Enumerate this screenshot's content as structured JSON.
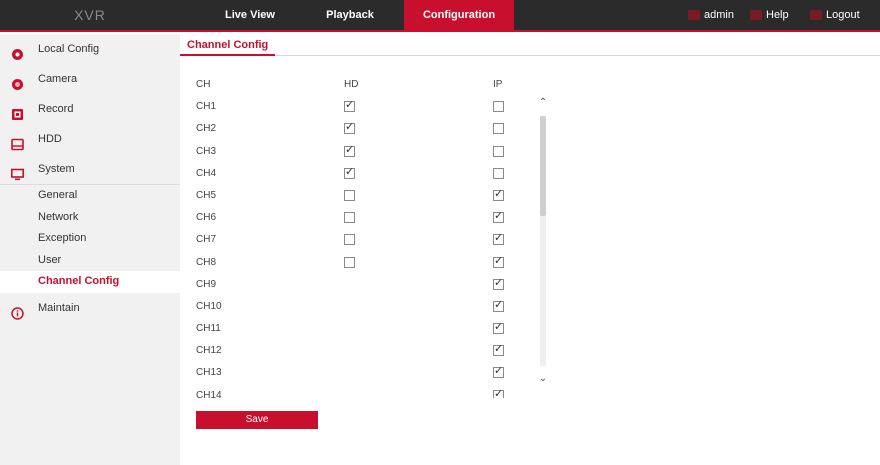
{
  "header": {
    "brand": "XVR",
    "nav": [
      {
        "label": "Live View"
      },
      {
        "label": "Playback"
      },
      {
        "label": "Configuration",
        "active": true
      }
    ],
    "user": "admin",
    "help": "Help",
    "logout": "Logout"
  },
  "sidebar": {
    "items": [
      {
        "label": "Local Config",
        "icon": "local-config-icon"
      },
      {
        "label": "Camera",
        "icon": "camera-icon"
      },
      {
        "label": "Record",
        "icon": "record-icon"
      },
      {
        "label": "HDD",
        "icon": "hdd-icon"
      },
      {
        "label": "System",
        "icon": "monitor-icon"
      },
      {
        "label": "Maintain",
        "icon": "info-icon"
      }
    ],
    "system_sub": [
      {
        "label": "General"
      },
      {
        "label": "Network"
      },
      {
        "label": "Exception"
      },
      {
        "label": "User"
      },
      {
        "label": "Channel Config",
        "active": true
      }
    ]
  },
  "content": {
    "tab": "Channel Config",
    "columns": {
      "ch": "CH",
      "hd": "HD",
      "ip": "IP"
    },
    "rows": [
      {
        "ch": "CH1",
        "hd": true,
        "ip": false
      },
      {
        "ch": "CH2",
        "hd": true,
        "ip": false
      },
      {
        "ch": "CH3",
        "hd": true,
        "ip": false
      },
      {
        "ch": "CH4",
        "hd": true,
        "ip": false
      },
      {
        "ch": "CH5",
        "hd": false,
        "ip": true
      },
      {
        "ch": "CH6",
        "hd": false,
        "ip": true
      },
      {
        "ch": "CH7",
        "hd": false,
        "ip": true
      },
      {
        "ch": "CH8",
        "hd": false,
        "ip": true
      },
      {
        "ch": "CH9",
        "hd": null,
        "ip": true
      },
      {
        "ch": "CH10",
        "hd": null,
        "ip": true
      },
      {
        "ch": "CH11",
        "hd": null,
        "ip": true
      },
      {
        "ch": "CH12",
        "hd": null,
        "ip": true
      },
      {
        "ch": "CH13",
        "hd": null,
        "ip": true
      },
      {
        "ch": "CH14",
        "hd": null,
        "ip": true
      }
    ],
    "save_label": "Save"
  },
  "colors": {
    "accent": "#c8102e",
    "topbar": "#2b2b2b",
    "sidebar": "#f1f1f1"
  }
}
